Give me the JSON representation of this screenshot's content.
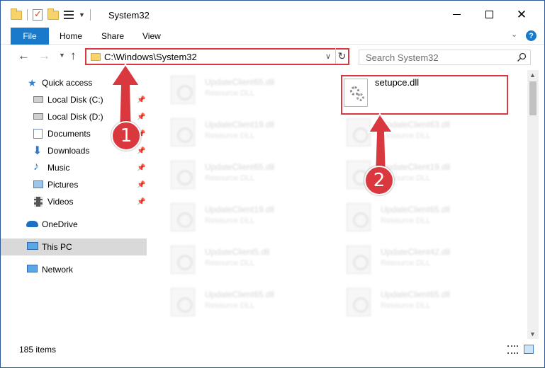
{
  "window": {
    "title": "System32",
    "accent": "#1979ca",
    "annotation_color": "#d9383f"
  },
  "ribbon": {
    "file_label": "File",
    "home_label": "Home",
    "share_label": "Share",
    "view_label": "View",
    "help_label": "?"
  },
  "navbar": {
    "path": "C:\\Windows\\System32",
    "search_placeholder": "Search System32"
  },
  "sidebar": {
    "items": [
      {
        "label": "Quick access",
        "icon": "star-icon"
      },
      {
        "label": "Local Disk (C:)",
        "icon": "drive-icon",
        "pinned": true
      },
      {
        "label": "Local Disk (D:)",
        "icon": "drive-icon",
        "pinned": true
      },
      {
        "label": "Documents",
        "icon": "documents-icon",
        "pinned": true
      },
      {
        "label": "Downloads",
        "icon": "download-icon",
        "pinned": true
      },
      {
        "label": "Music",
        "icon": "music-icon",
        "pinned": true
      },
      {
        "label": "Pictures",
        "icon": "pictures-icon",
        "pinned": true
      },
      {
        "label": "Videos",
        "icon": "videos-icon",
        "pinned": true
      },
      {
        "label": "OneDrive",
        "icon": "cloud-icon"
      },
      {
        "label": "This PC",
        "icon": "computer-icon",
        "selected": true
      },
      {
        "label": "Network",
        "icon": "network-icon"
      }
    ]
  },
  "files": {
    "left_column": [
      {
        "name": "UpdateClient65.dll",
        "type": "Resource DLL"
      },
      {
        "name": "UpdateClient19.dll",
        "type": "Resource DLL"
      },
      {
        "name": "UpdateClient65.dll",
        "type": "Resource DLL"
      },
      {
        "name": "UpdateClient19.dll",
        "type": "Resource DLL"
      },
      {
        "name": "UpdateClient5.dll",
        "type": "Resource DLL"
      },
      {
        "name": "UpdateClient65.dll",
        "type": "Resource DLL"
      }
    ],
    "right_column": [
      {
        "name": "UpdateClient63.dll",
        "type": "Resource DLL"
      },
      {
        "name": "UpdateClient19.dll",
        "type": "Resource DLL"
      },
      {
        "name": "UpdateClient65.dll",
        "type": "Resource DLL"
      },
      {
        "name": "UpdateClient42.dll",
        "type": "Resource DLL"
      },
      {
        "name": "UpdateClient65.dll",
        "type": "Resource DLL"
      }
    ],
    "highlighted": {
      "name": "setupce.dll"
    }
  },
  "annotations": {
    "step1": "1",
    "step2": "2"
  },
  "status": {
    "item_count": "185 items"
  }
}
